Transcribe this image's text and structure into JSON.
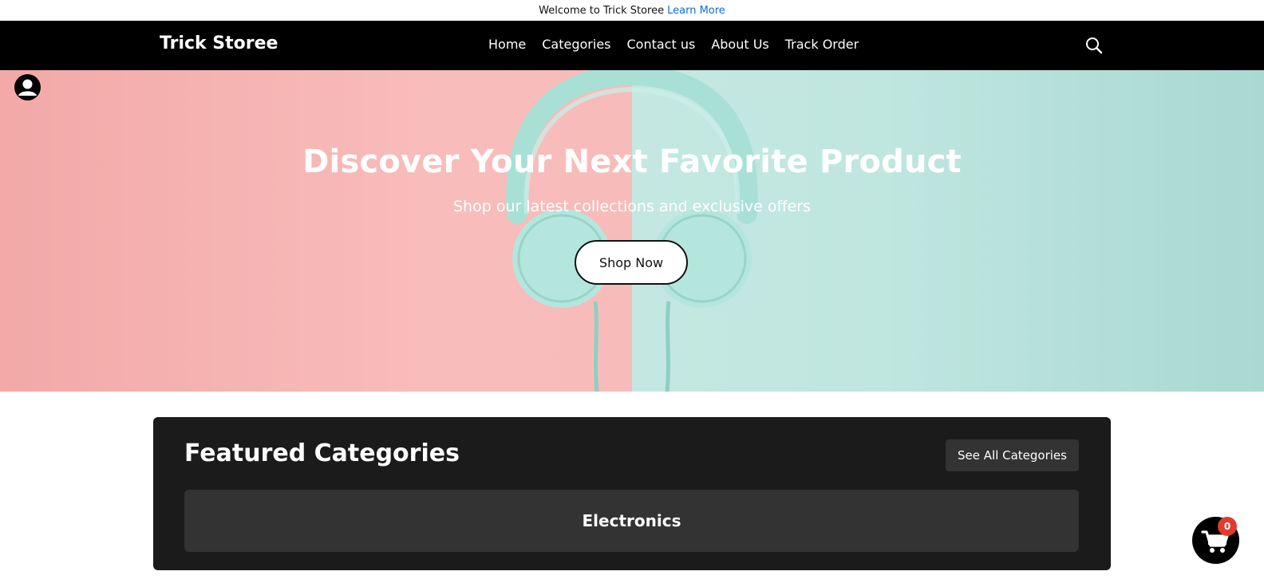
{
  "announcement": {
    "text": "Welcome to Trick Storee",
    "link_label": "Learn More",
    "link_color": "#0a6fd6"
  },
  "navbar": {
    "brand": "Trick Storee",
    "links": [
      "Home",
      "Categories",
      "Contact us",
      "About Us",
      "Track Order"
    ],
    "search_icon": "search-icon"
  },
  "hero": {
    "title": "Discover Your Next Favorite Product",
    "subtitle": "Shop our latest collections and exclusive offers",
    "cta_label": "Shop Now",
    "colors": {
      "left": "#f7bcba",
      "right": "#c4e8e1",
      "headphones": "#a8e0d6"
    }
  },
  "user_icon": "user-avatar-icon",
  "featured": {
    "title": "Featured Categories",
    "see_all_label": "See All Categories",
    "categories": [
      "Electronics"
    ]
  },
  "cart": {
    "icon": "cart-icon",
    "count": "0",
    "badge_color": "#e23b2e"
  }
}
